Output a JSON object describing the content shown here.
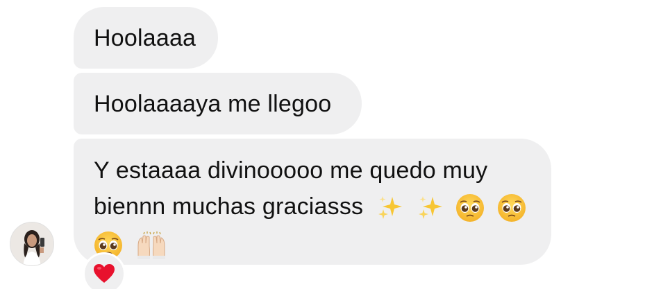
{
  "chat": {
    "messages": [
      {
        "text": "Hoolaaaa"
      },
      {
        "text": "Hoolaaaaya me llegoo"
      },
      {
        "line1": "Y estaaaa divinooooo me quedo muy",
        "line2": "biennn muchas graciasss",
        "emojis": [
          "sparkles-icon",
          "sparkles-icon",
          "pleading-face-icon",
          "pleading-face-icon",
          "pleading-face-icon",
          "raising-hands-icon"
        ]
      }
    ],
    "reaction": "red-heart-icon"
  },
  "colors": {
    "bubble": "#efeff0",
    "text": "#111111",
    "background": "#ffffff",
    "heart": "#e8112d"
  }
}
